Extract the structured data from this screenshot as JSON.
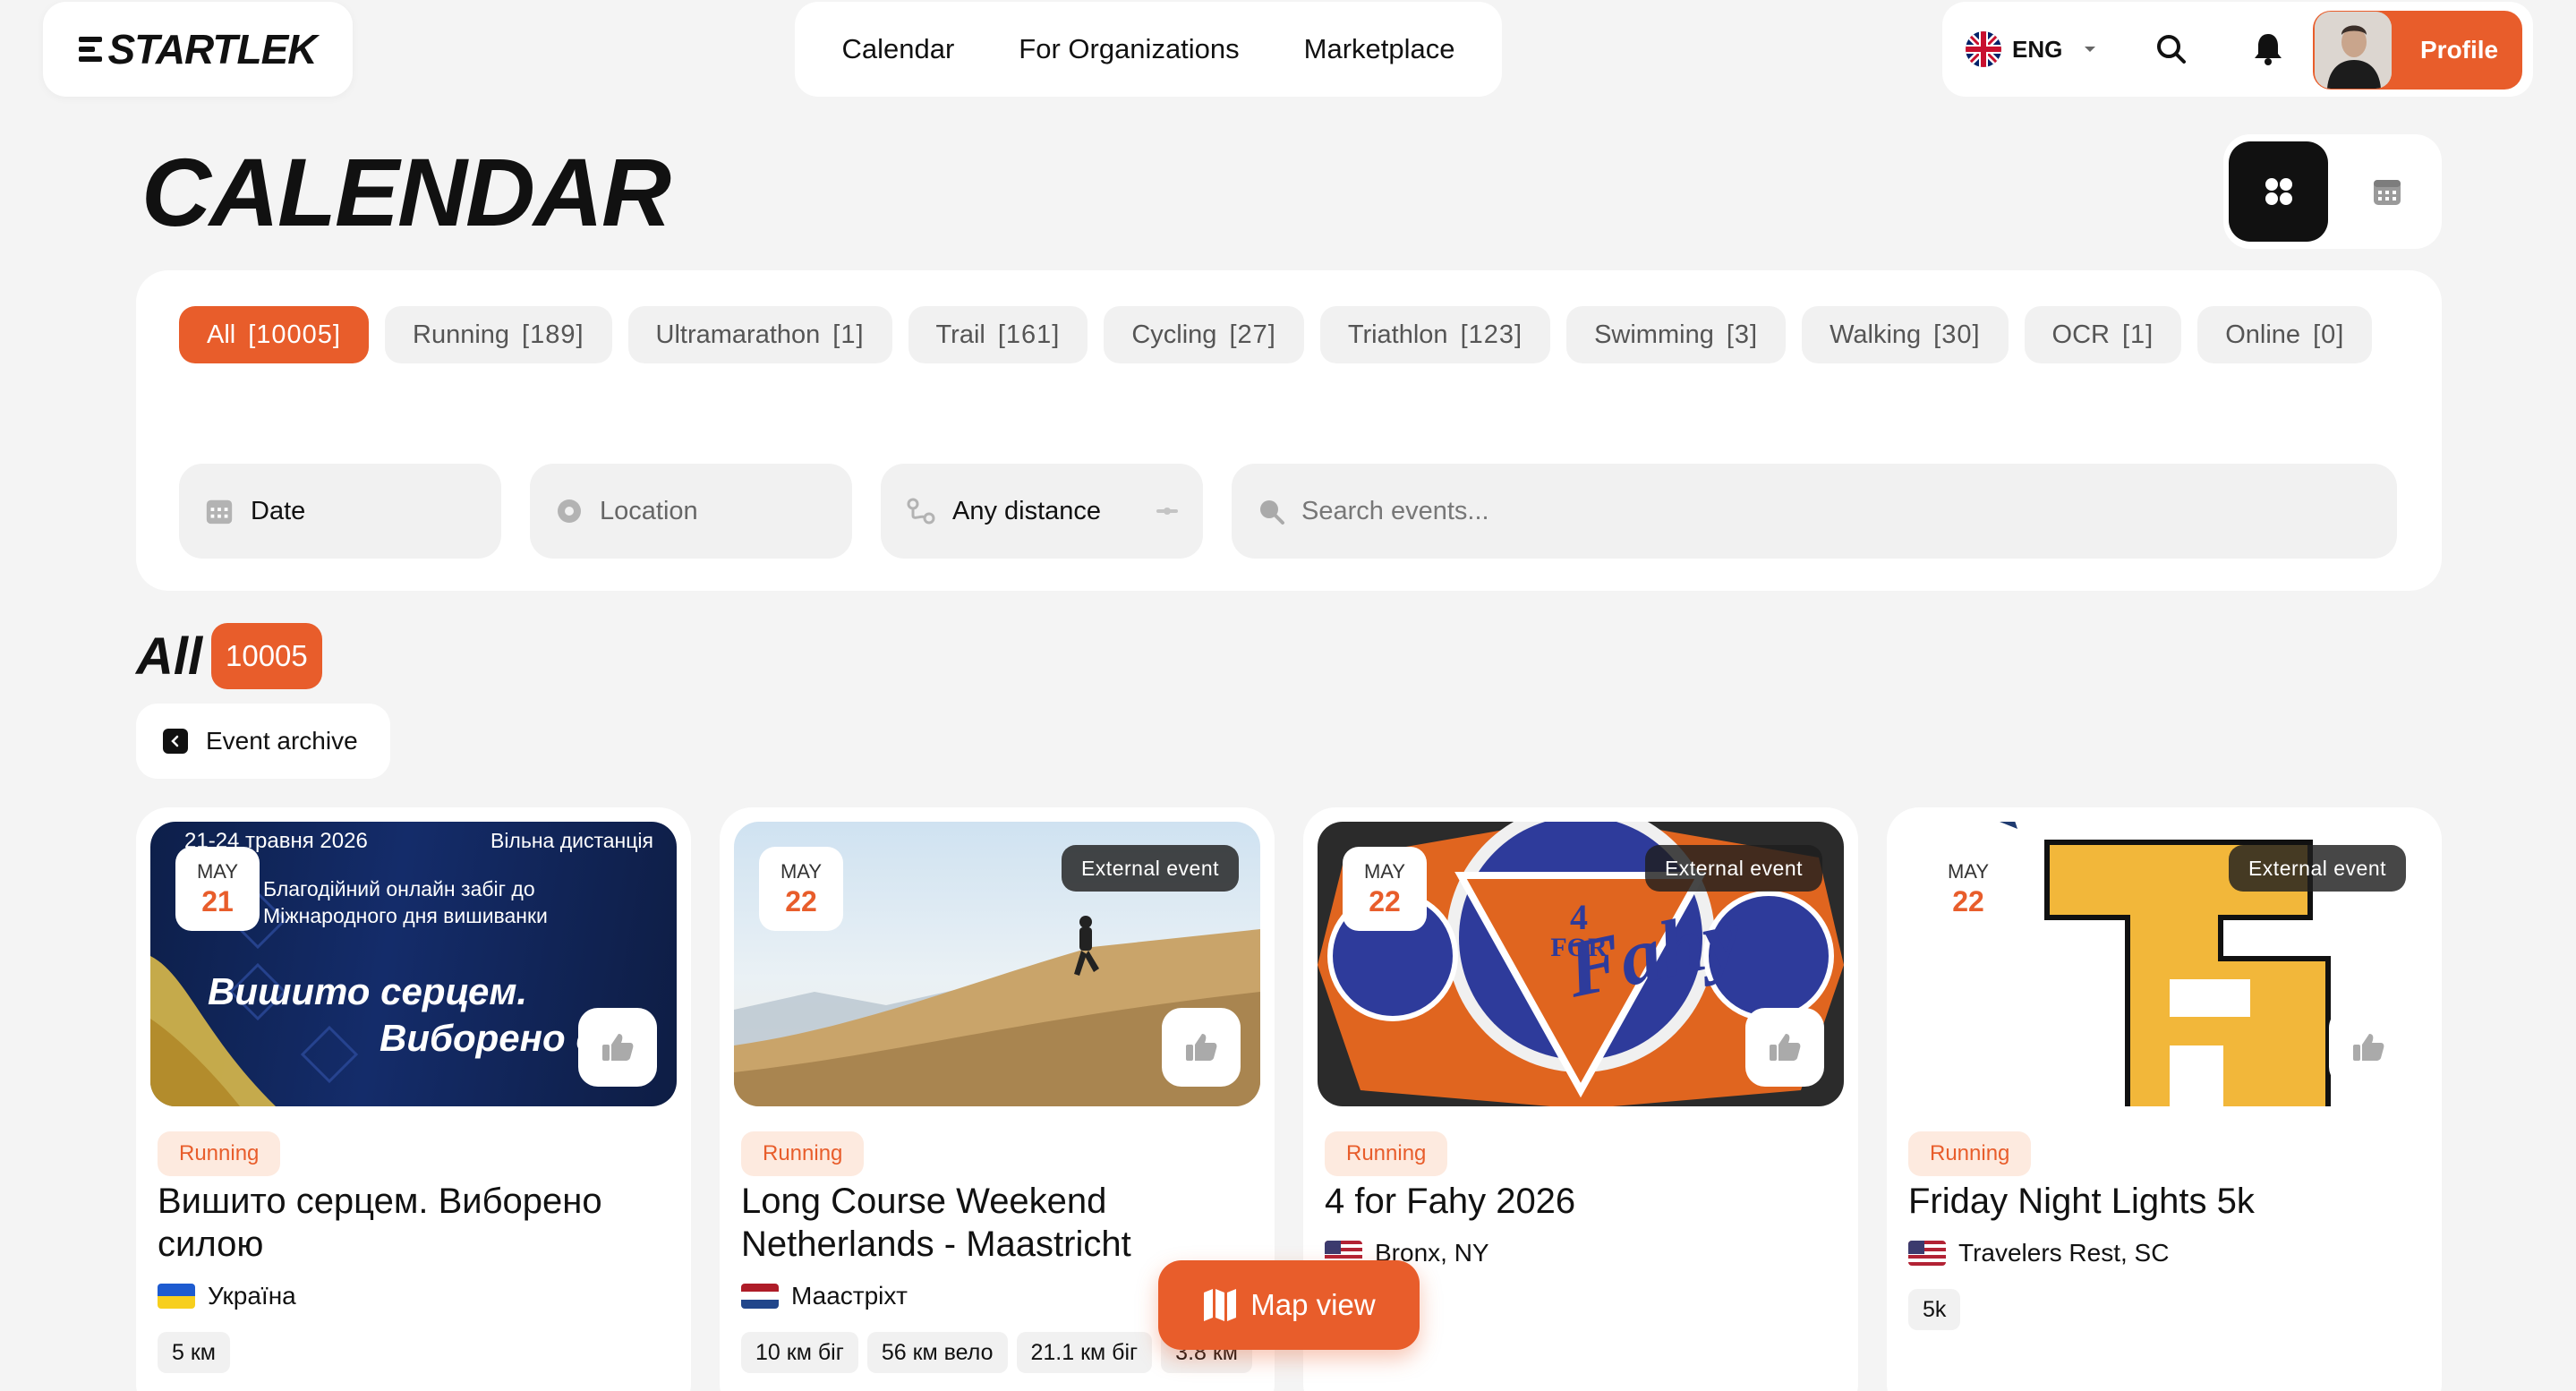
{
  "brand": {
    "logo": "STARTLEK"
  },
  "nav": {
    "items": [
      "Calendar",
      "For Organizations",
      "Marketplace"
    ]
  },
  "header": {
    "lang": "ENG",
    "profile_label": "Profile"
  },
  "page": {
    "title": "CALENDAR"
  },
  "categories": [
    {
      "label": "All",
      "count": "[10005]",
      "active": true
    },
    {
      "label": "Running",
      "count": "[189]"
    },
    {
      "label": "Ultramarathon",
      "count": "[1]"
    },
    {
      "label": "Trail",
      "count": "[161]"
    },
    {
      "label": "Cycling",
      "count": "[27]"
    },
    {
      "label": "Triathlon",
      "count": "[123]"
    },
    {
      "label": "Swimming",
      "count": "[3]"
    },
    {
      "label": "Walking",
      "count": "[30]"
    },
    {
      "label": "OCR",
      "count": "[1]"
    },
    {
      "label": "Online",
      "count": "[0]"
    }
  ],
  "filters": {
    "date": "Date",
    "location": "Location",
    "distance": "Any distance",
    "search_placeholder": "Search events..."
  },
  "results": {
    "heading": "All",
    "count": "10005",
    "archive": "Event archive"
  },
  "events": [
    {
      "month": "MAY",
      "day": "21",
      "external": "",
      "category": "Running",
      "title": "Вишито серцем. Виборено силою",
      "location": "Україна",
      "tags": [
        "5 км"
      ],
      "poster": {
        "date_text": "21-24 травня 2026",
        "corner": "Вільна дистанція",
        "sub": "Благодійний онлайн забіг до Міжнародного дня вишиванки",
        "l1": "Вишито серцем.",
        "l2": "Виборено си"
      }
    },
    {
      "month": "MAY",
      "day": "22",
      "external": "External event",
      "category": "Running",
      "title": "Long Course Weekend Netherlands - Maastricht",
      "location": "Маастріхт",
      "tags": [
        "10 км біг",
        "56 км вело",
        "21.1 км біг",
        "3.8 км"
      ]
    },
    {
      "month": "MAY",
      "day": "22",
      "external": "External event",
      "category": "Running",
      "title": "4 for Fahy 2026",
      "location": "Bronx, NY",
      "tags": [],
      "poster": {
        "small": "4",
        "for": "FOR",
        "name": "Fahy"
      }
    },
    {
      "month": "MAY",
      "day": "22",
      "external": "External event",
      "category": "Running",
      "title": "Friday Night Lights 5k",
      "location": "Travelers Rest, SC",
      "tags": [
        "5k"
      ]
    }
  ],
  "map_button": "Map view",
  "colors": {
    "accent": "#e85d2b",
    "accent_soft": "#fdeadf",
    "background": "#f4f4f4"
  }
}
